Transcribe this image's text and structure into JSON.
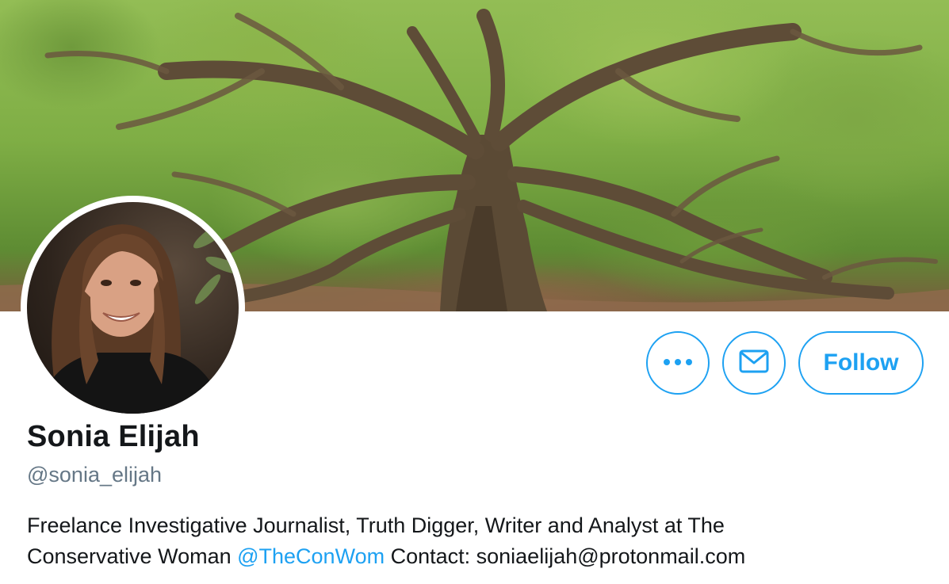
{
  "profile": {
    "display_name": "Sonia Elijah",
    "handle": "@sonia_elijah",
    "bio": {
      "line1": "Freelance Investigative Journalist, Truth Digger, Writer and Analyst at The",
      "line2_before": "Conservative Woman ",
      "mention": "@TheConWom",
      "line2_after": " Contact: soniaelijah@protonmail.com"
    }
  },
  "actions": {
    "more_icon": "more-dots-icon",
    "message_icon": "envelope-icon",
    "follow_label": "Follow"
  },
  "colors": {
    "accent": "#1da1f2",
    "text": "#14171a",
    "secondary_text": "#657786"
  },
  "images": {
    "banner": "live-oak-tree-header",
    "avatar": "profile-photo"
  }
}
